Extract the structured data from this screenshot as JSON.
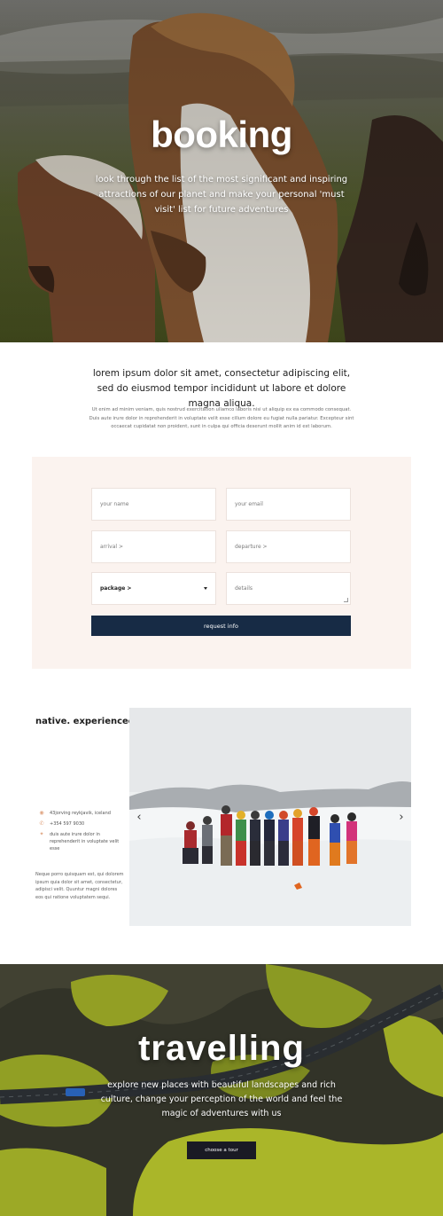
{
  "hero": {
    "title": "booking",
    "subtitle": "look through the list of the most significant and inspiring attractions of our planet and make your personal 'must visit' list for future adventures"
  },
  "intro": {
    "lead": "lorem ipsum dolor sit amet, consectetur adipiscing elit, sed do eiusmod tempor incididunt ut labore et dolore magna aliqua.",
    "body": "Ut enim ad minim veniam, quis nostrud exercitation ullamco laboris nisi ut aliquip ex ea commodo consequat. Duis aute irure dolor in reprehenderit in voluptate velit esse cillum dolore eu fugiat nulla pariatur. Excepteur sint occaecat cupidatat non proident, sunt in culpa qui officia deserunt mollit anim id est laborum."
  },
  "form": {
    "name_placeholder": "your name",
    "email_placeholder": "your email",
    "arrival_placeholder": "arrival >",
    "departure_placeholder": "departure >",
    "package_label": "package >",
    "details_placeholder": "details",
    "submit_label": "request info",
    "panel_color": "#fbf3ef",
    "button_color": "#172b45"
  },
  "guides": {
    "title": "native. experienced.",
    "contacts": [
      {
        "icon": "location-icon",
        "text": "43jorving reykjavik, iceland"
      },
      {
        "icon": "phone-icon",
        "text": "+354 597 9030"
      },
      {
        "icon": "info-icon",
        "text": "duis aute irure dolor in reprehenderit in voluptate velit esse"
      }
    ],
    "paragraph": "Neque porro quisquam est, qui dolorem ipsum quia dolor sit amet, consectetur, adipisci velit. Quuntur magni dolores eos qui ratione voluptatem sequi.",
    "accent_color": "#e0a683",
    "prev_arrow": "‹",
    "next_arrow": "›"
  },
  "travel": {
    "title": "travelling",
    "subtitle": "explore new places with beautiful landscapes and rich culture, change your perception of the world and feel the magic of adventures with us",
    "button_label": "choose a tour"
  }
}
